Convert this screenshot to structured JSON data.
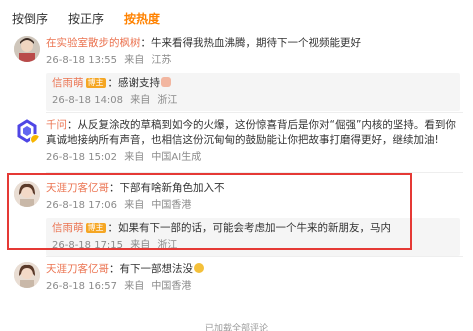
{
  "tabs": {
    "reverse": "按倒序",
    "forward": "按正序",
    "hot": "按热度"
  },
  "comments": [
    {
      "user": "在实验室散步的枫树",
      "sep": "：",
      "text": "牛来看得我热血沸腾，期待下一个视频能更好",
      "time": "26-8-18 13:55",
      "from": "来自",
      "loc": "江苏",
      "reply": {
        "user": "信雨萌",
        "badge": "博主",
        "sep": "：",
        "text": "感谢支持",
        "time": "26-8-18 14:08",
        "from": "来自",
        "loc": "浙江"
      }
    },
    {
      "user": "千问",
      "sep": "：",
      "text_line1": "从反复涂改的草稿到如今的火爆，这份惊喜背后是你对“倔强”内核的坚持。看到你",
      "text_line2": "真诚地接纳所有声音，也相信这份沉甸甸的鼓励能让你把故事打磨得更好，继续加油!",
      "time": "26-8-18 15:02",
      "from": "来自",
      "loc": "中国AI生成"
    },
    {
      "user": "天涯刀客亿哥",
      "sep": "：",
      "text": "下部有啥新角色加入不",
      "time": "26-8-18 17:06",
      "from": "来自",
      "loc": "中国香港",
      "reply": {
        "user": "信雨萌",
        "badge": "博主",
        "sep": "：",
        "text": "如果有下一部的话，可能会考虑加一个牛来的新朋友，马内",
        "time": "26-8-18 17:15",
        "from": "来自",
        "loc": "浙江"
      }
    },
    {
      "user": "天涯刀客亿哥",
      "sep": "：",
      "text": "有下一部想法没",
      "time": "26-8-18 16:57",
      "from": "来自",
      "loc": "中国香港"
    }
  ],
  "footer": "已加载全部评论",
  "colors": {
    "accent": "#ff8200",
    "username": "#eb7350",
    "highlight": "#e53935"
  }
}
